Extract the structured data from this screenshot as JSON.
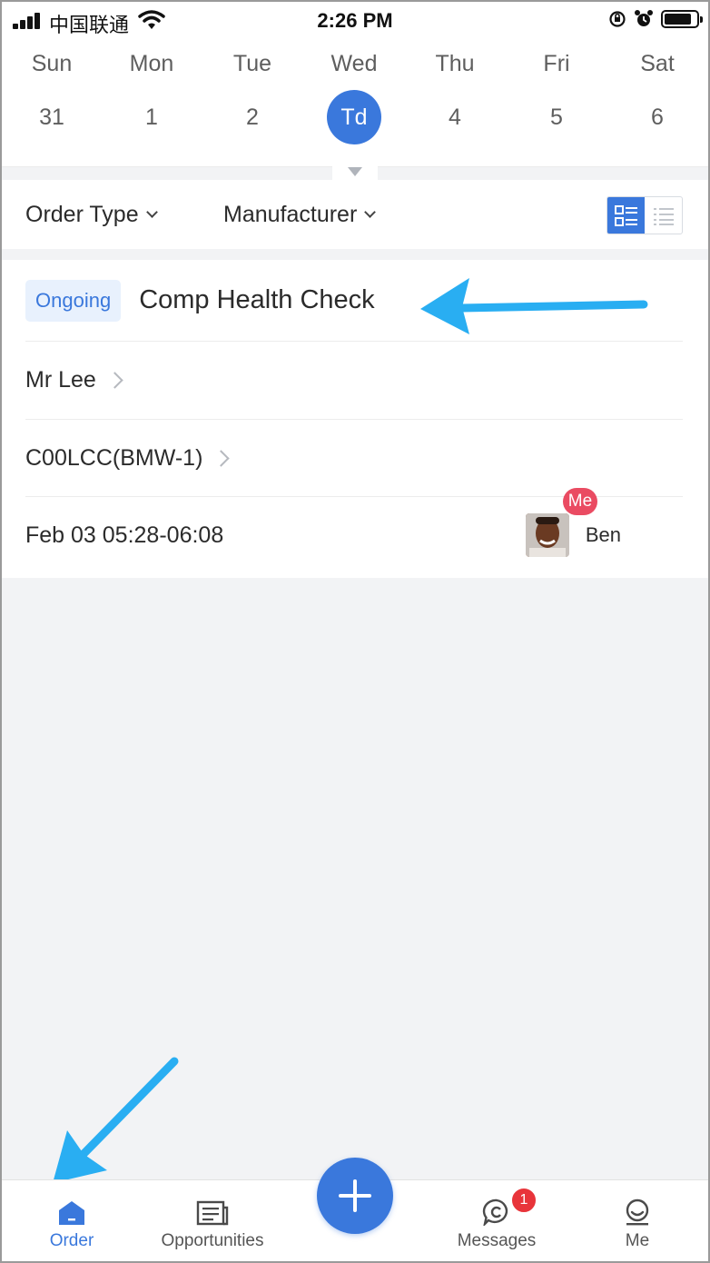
{
  "status_bar": {
    "carrier": "中国联通",
    "time": "2:26 PM"
  },
  "calendar": {
    "days": [
      {
        "name": "Sun",
        "num": "31"
      },
      {
        "name": "Mon",
        "num": "1"
      },
      {
        "name": "Tue",
        "num": "2"
      },
      {
        "name": "Wed",
        "num": "Td"
      },
      {
        "name": "Thu",
        "num": "4"
      },
      {
        "name": "Fri",
        "num": "5"
      },
      {
        "name": "Sat",
        "num": "6"
      }
    ],
    "selected_day": "Wed"
  },
  "filters": {
    "order_type_label": "Order Type",
    "manufacturer_label": "Manufacturer",
    "view_mode": "card"
  },
  "order": {
    "status": "Ongoing",
    "title": "Comp Health Check",
    "customer": "Mr Lee",
    "vehicle": "C00LCC(BMW-1)",
    "schedule": "Feb 03 05:28-06:08",
    "assignee_tag": "Me",
    "assignee_name": "Ben"
  },
  "tabbar": {
    "tabs": [
      {
        "label": "Order",
        "icon": "home-icon",
        "active": true
      },
      {
        "label": "Opportunities",
        "icon": "newspaper-icon",
        "active": false
      },
      {
        "label": "Messages",
        "icon": "chat-icon",
        "active": false,
        "badge": "1"
      },
      {
        "label": "Me",
        "icon": "smiley-icon",
        "active": false
      }
    ],
    "fab_icon": "plus-icon"
  },
  "colors": {
    "accent": "#3a78dc",
    "annotation_arrow": "#29aef2",
    "badge_red": "#e8343a"
  }
}
